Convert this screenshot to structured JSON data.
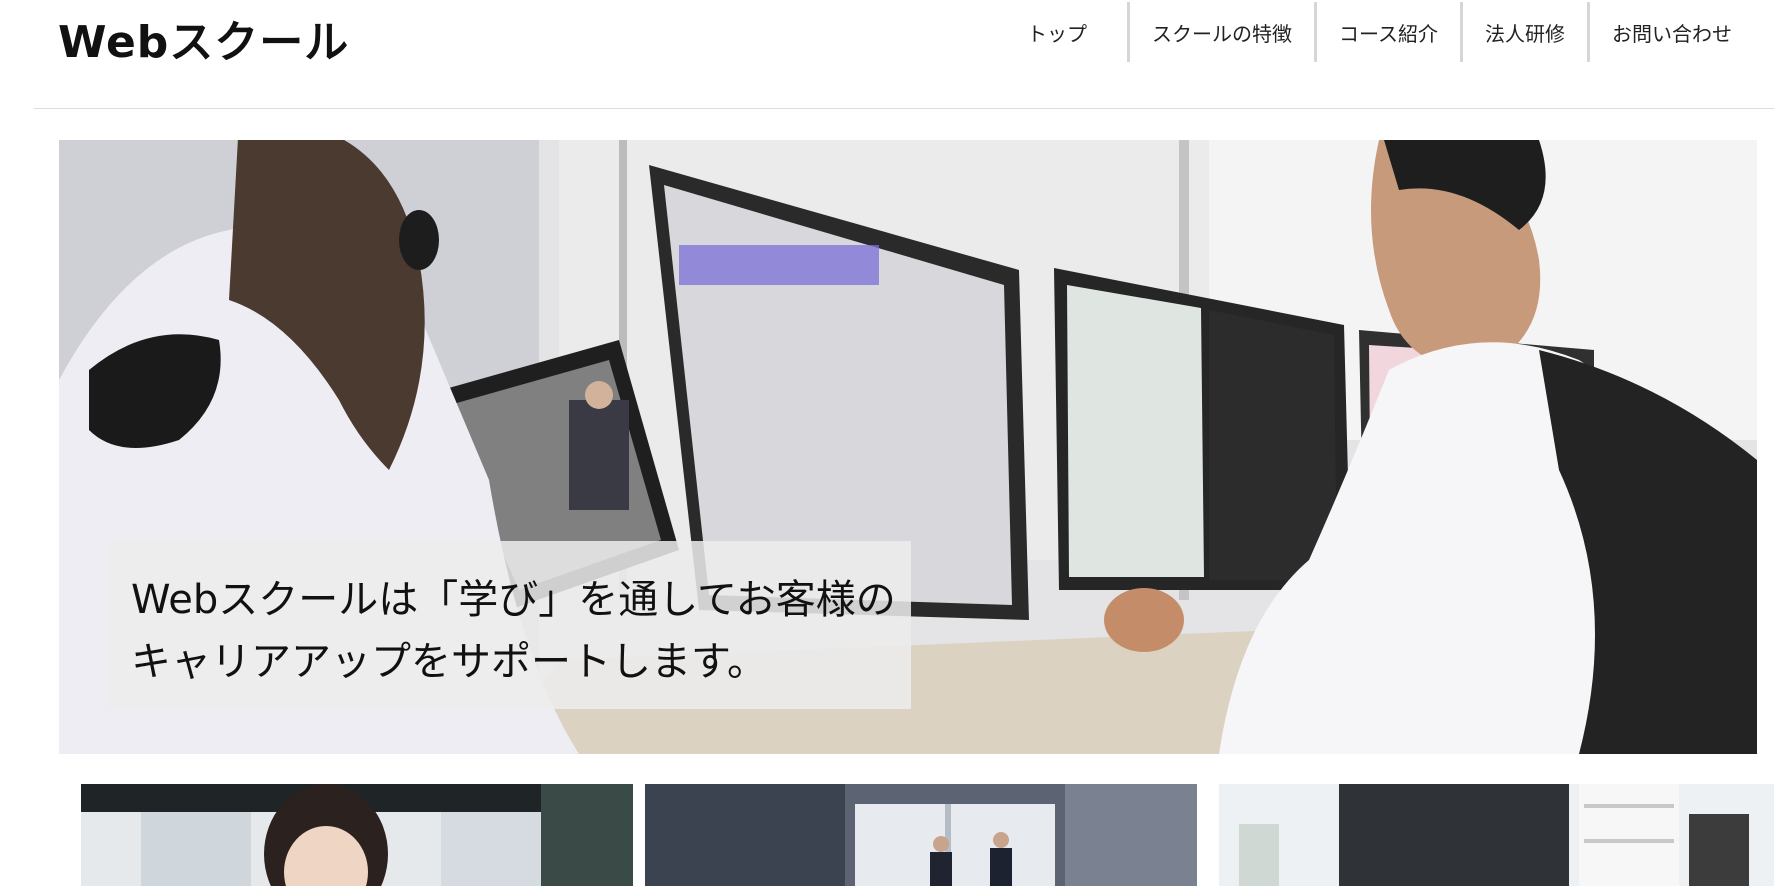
{
  "site": {
    "logo": "Webスクール"
  },
  "nav": {
    "items": [
      {
        "label": "トップ"
      },
      {
        "label": "スクールの特徴"
      },
      {
        "label": "コース紹介"
      },
      {
        "label": "法人研修"
      },
      {
        "label": "お問い合わせ"
      }
    ]
  },
  "hero": {
    "caption_line1": "Webスクールは「学び」を通してお客様の",
    "caption_line2": "キャリアアップをサポートします。"
  },
  "colors": {
    "text": "#111111",
    "caption_bg": "#ececec",
    "nav_divider": "#d6d6d6"
  }
}
